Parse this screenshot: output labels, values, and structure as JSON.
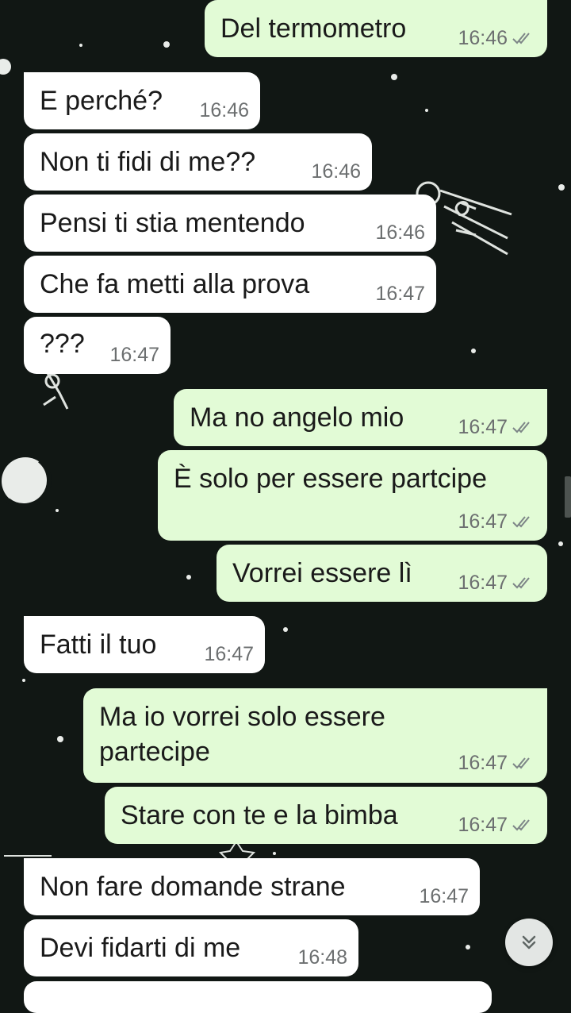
{
  "colors": {
    "background": "#111714",
    "incoming_bubble": "#ffffff",
    "outgoing_bubble": "#e2fbd6",
    "meta_text": "#6c6f70"
  },
  "messages": [
    {
      "text": "Del termometro",
      "time": "16:46",
      "status": "read-ticks-icon",
      "direction": "outgoing"
    },
    {
      "text": "E perché?",
      "time": "16:46",
      "direction": "incoming"
    },
    {
      "text": "Non ti fidi di me??",
      "time": "16:46",
      "direction": "incoming"
    },
    {
      "text": "Pensi ti stia mentendo",
      "time": "16:46",
      "direction": "incoming"
    },
    {
      "text": "Che fa metti alla prova",
      "time": "16:47",
      "direction": "incoming"
    },
    {
      "text": "???",
      "time": "16:47",
      "direction": "incoming"
    },
    {
      "text": "Ma no angelo mio",
      "time": "16:47",
      "status": "read-ticks-icon",
      "direction": "outgoing"
    },
    {
      "text": "È solo per essere partcipe",
      "time": "16:47",
      "status": "read-ticks-icon",
      "direction": "outgoing"
    },
    {
      "text": "Vorrei essere lì",
      "time": "16:47",
      "status": "read-ticks-icon",
      "direction": "outgoing"
    },
    {
      "text": "Fatti il tuo",
      "time": "16:47",
      "direction": "incoming"
    },
    {
      "text_line1": "Ma io vorrei solo essere",
      "text_line2": "partecipe",
      "time": "16:47",
      "status": "read-ticks-icon",
      "direction": "outgoing"
    },
    {
      "text": "Stare con te e la bimba",
      "time": "16:47",
      "status": "read-ticks-icon",
      "direction": "outgoing"
    },
    {
      "text": "Non fare domande strane",
      "time": "16:47",
      "direction": "incoming"
    },
    {
      "text": "Devi fidarti di me",
      "time": "16:48",
      "direction": "incoming"
    }
  ],
  "scroll_button": {
    "icon": "double-chevron-down-icon"
  }
}
